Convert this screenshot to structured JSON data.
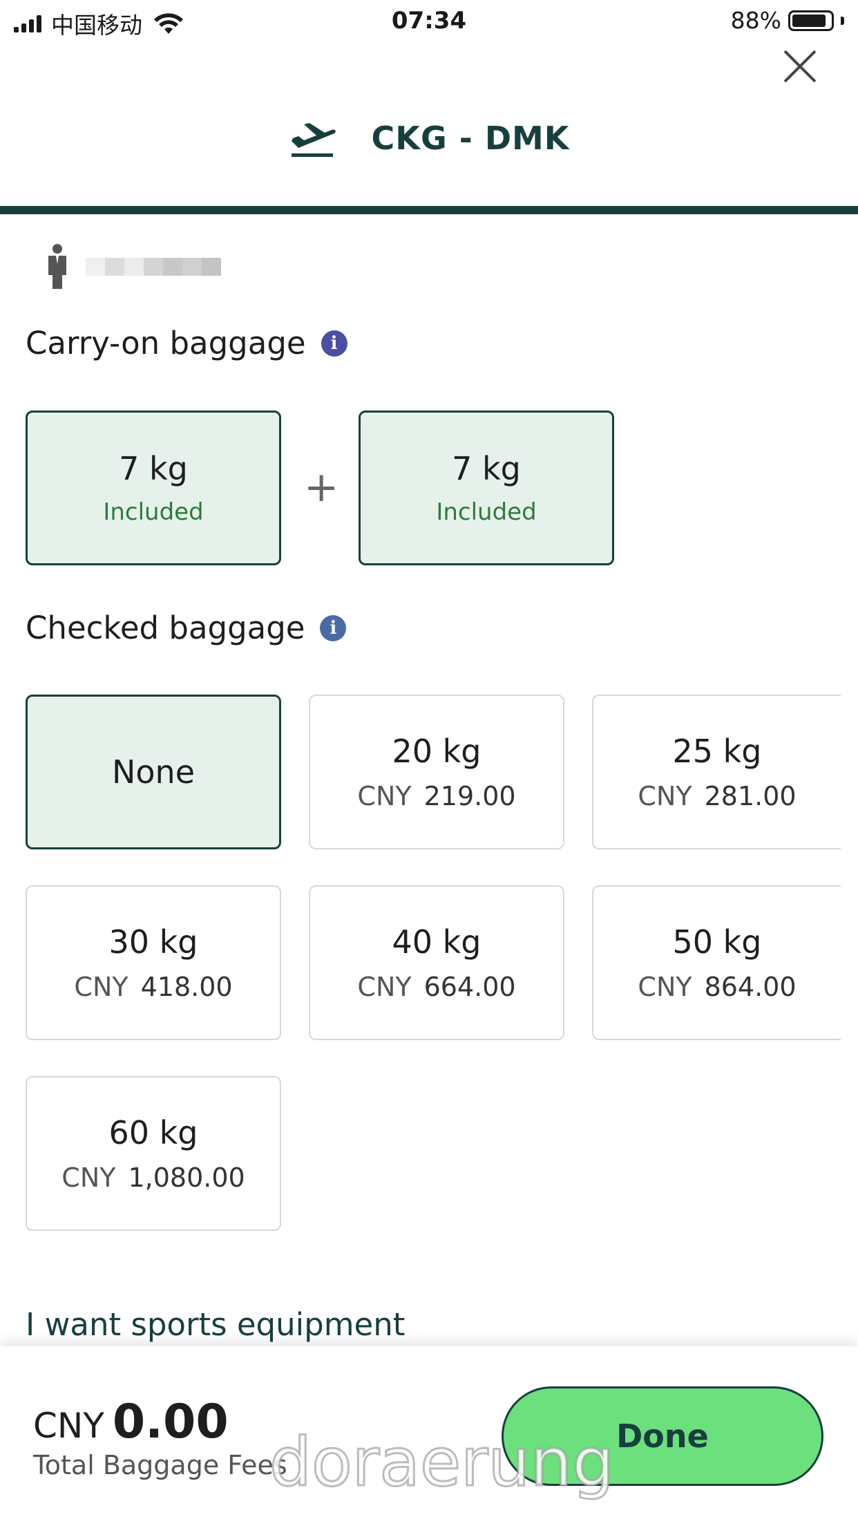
{
  "status_bar": {
    "carrier": "中国移动",
    "time": "07:34",
    "battery": "88%",
    "battery_level": 0.88
  },
  "header": {
    "route": "CKG - DMK",
    "icon": "plane-departure-icon",
    "close_icon": "close-icon"
  },
  "passenger": {
    "icon": "person-icon",
    "name_blurred": true
  },
  "carry_on": {
    "title": "Carry-on baggage",
    "info_color": "#4a4fa3",
    "items": [
      {
        "weight": "7 kg",
        "status": "Included"
      },
      {
        "weight": "7 kg",
        "status": "Included"
      }
    ],
    "plus": "+"
  },
  "checked": {
    "title": "Checked baggage",
    "info_color": "#4a6aa3",
    "none_label": "None",
    "options": [
      {
        "weight": "20 kg",
        "currency": "CNY",
        "price": "219.00"
      },
      {
        "weight": "25 kg",
        "currency": "CNY",
        "price": "281.00"
      },
      {
        "weight": "30 kg",
        "currency": "CNY",
        "price": "418.00"
      },
      {
        "weight": "40 kg",
        "currency": "CNY",
        "price": "664.00"
      },
      {
        "weight": "50 kg",
        "currency": "CNY",
        "price": "864.00"
      },
      {
        "weight": "60 kg",
        "currency": "CNY",
        "price": "1,080.00"
      }
    ]
  },
  "sports_link": "I want sports equipment",
  "footer": {
    "currency": "CNY",
    "amount": "0.00",
    "label": "Total Baggage Fees",
    "done": "Done"
  },
  "watermark": "doraerung",
  "colors": {
    "brand_dark": "#173f3e",
    "selected_bg": "#e6f1eb",
    "done_green": "#6be07c",
    "included_green": "#2f7a3b"
  }
}
